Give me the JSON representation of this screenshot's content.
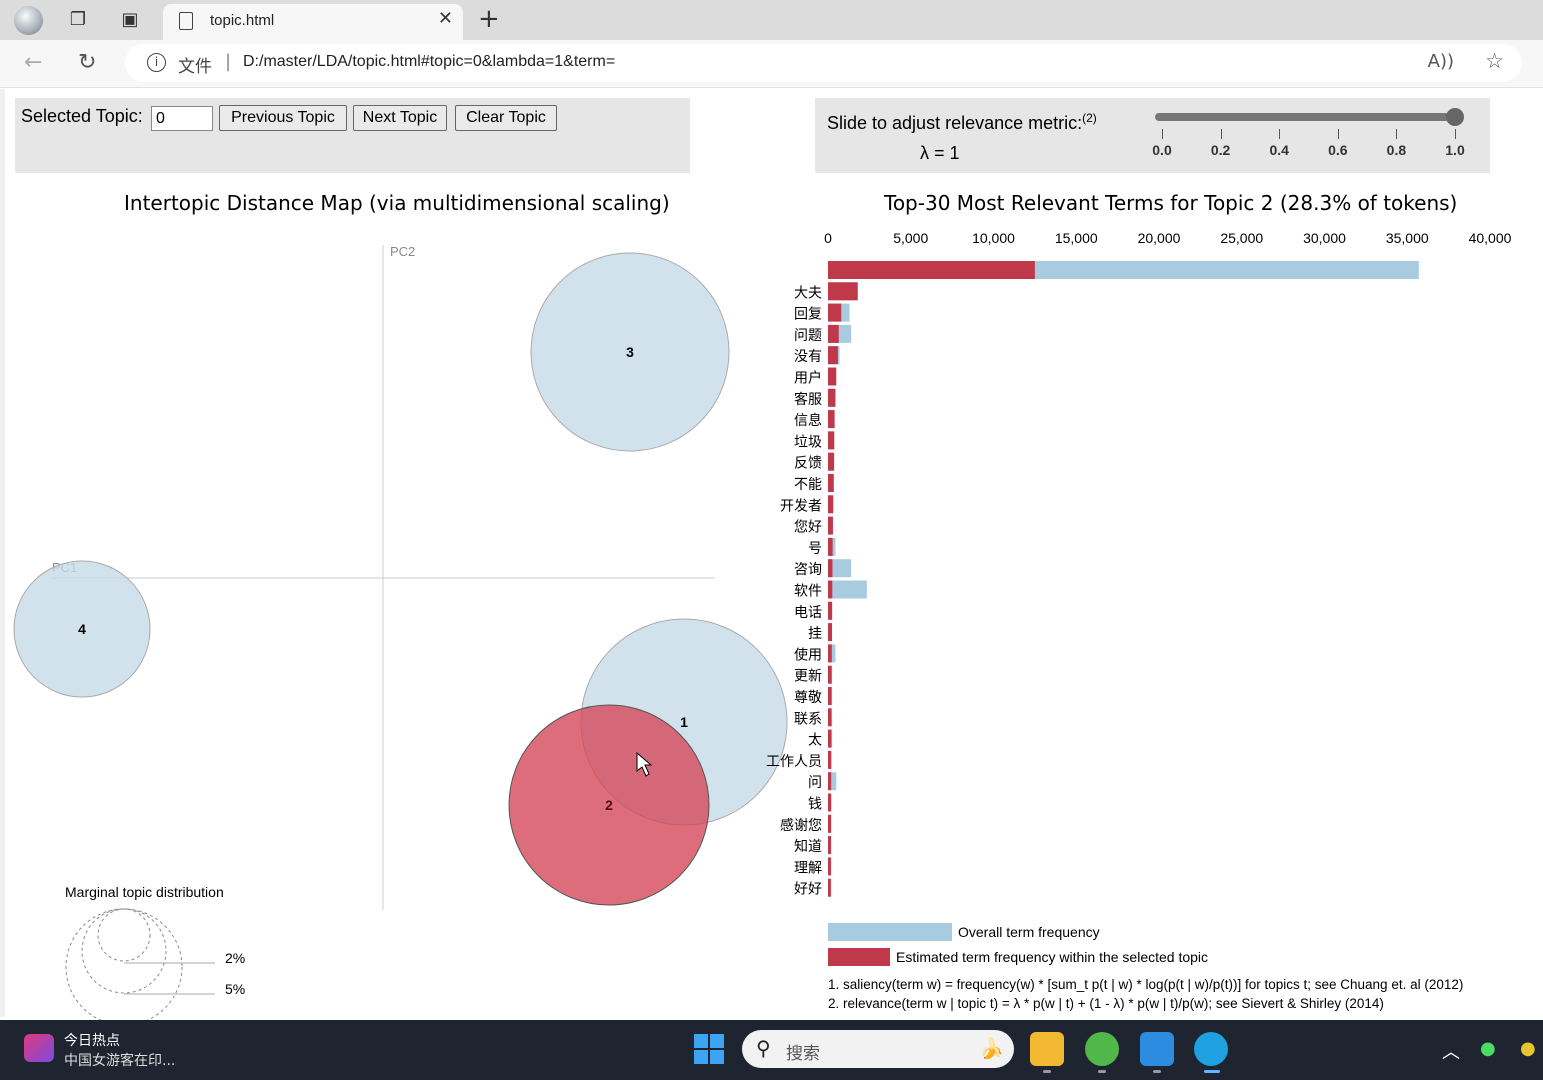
{
  "browser": {
    "tab_title": "topic.html",
    "new_tab_symbol": "+",
    "close_symbol": "✕",
    "security_label": "文件",
    "url": "D:/master/LDA/topic.html#topic=0&lambda=1&term="
  },
  "controls": {
    "selected_topic_label": "Selected Topic:",
    "selected_topic_value": "0",
    "prev_label": "Previous Topic",
    "next_label": "Next Topic",
    "clear_label": "Clear Topic",
    "relevance_label": "Slide to adjust relevance metric:",
    "relevance_sup": "(2)",
    "lambda_text": "λ = 1",
    "lambda_value": 1,
    "slider_ticks": [
      "0.0",
      "0.2",
      "0.4",
      "0.6",
      "0.8",
      "1.0"
    ]
  },
  "intertopic": {
    "title": "Intertopic Distance Map (via multidimensional scaling)",
    "pc1": "PC1",
    "pc2": "PC2",
    "topics": [
      {
        "id": "1",
        "selected": false
      },
      {
        "id": "2",
        "selected": true
      },
      {
        "id": "3",
        "selected": false
      },
      {
        "id": "4",
        "selected": false
      }
    ],
    "marginal_title": "Marginal topic distribution",
    "marginal_labels": [
      "2%",
      "5%"
    ]
  },
  "chart_data": {
    "type": "bar",
    "title": "Top-30 Most Relevant Terms for Topic 2 (28.3% of tokens)",
    "xlim": [
      0,
      40000
    ],
    "x_ticks": [
      "0",
      "5,000",
      "10,000",
      "15,000",
      "20,000",
      "25,000",
      "30,000",
      "35,000",
      "40,000"
    ],
    "terms": [
      "",
      "大夫",
      "回复",
      "问题",
      "没有",
      "用户",
      "客服",
      "信息",
      "垃圾",
      "反馈",
      "不能",
      "开发者",
      "您好",
      "号",
      "咨询",
      "软件",
      "电话",
      "挂",
      "使用",
      "更新",
      "尊敬",
      "联系",
      "太",
      "工作人员",
      "问",
      "钱",
      "感谢您",
      "知道",
      "理解",
      "好好"
    ],
    "series": [
      {
        "name": "Overall term frequency",
        "values": [
          35700,
          1750,
          1300,
          1400,
          700,
          450,
          400,
          350,
          300,
          300,
          250,
          250,
          250,
          450,
          1400,
          2350,
          250,
          250,
          450,
          250,
          250,
          250,
          250,
          200,
          500,
          200,
          200,
          200,
          200,
          200
        ]
      },
      {
        "name": "Estimated term frequency within the selected topic",
        "values": [
          12500,
          1800,
          800,
          650,
          600,
          500,
          450,
          400,
          380,
          370,
          350,
          320,
          300,
          280,
          270,
          260,
          250,
          240,
          230,
          220,
          215,
          210,
          205,
          200,
          195,
          190,
          185,
          180,
          175,
          170
        ]
      }
    ],
    "legend": [
      "Overall term frequency",
      "Estimated term frequency within the selected topic"
    ],
    "colors": {
      "overall": "#a9cbe0",
      "topic": "#c0394b"
    }
  },
  "footnotes": [
    "1. saliency(term w) = frequency(w) * [sum_t p(t | w) * log(p(t | w)/p(t))] for topics t; see Chuang et. al (2012)",
    "2. relevance(term w | topic t) = λ * p(w | t) + (1 - λ) * p(w | t)/p(w); see Sievert & Shirley (2014)"
  ],
  "taskbar": {
    "news_title": "今日热点",
    "news_sub": "中国女游客在印...",
    "search_placeholder": "搜索"
  }
}
